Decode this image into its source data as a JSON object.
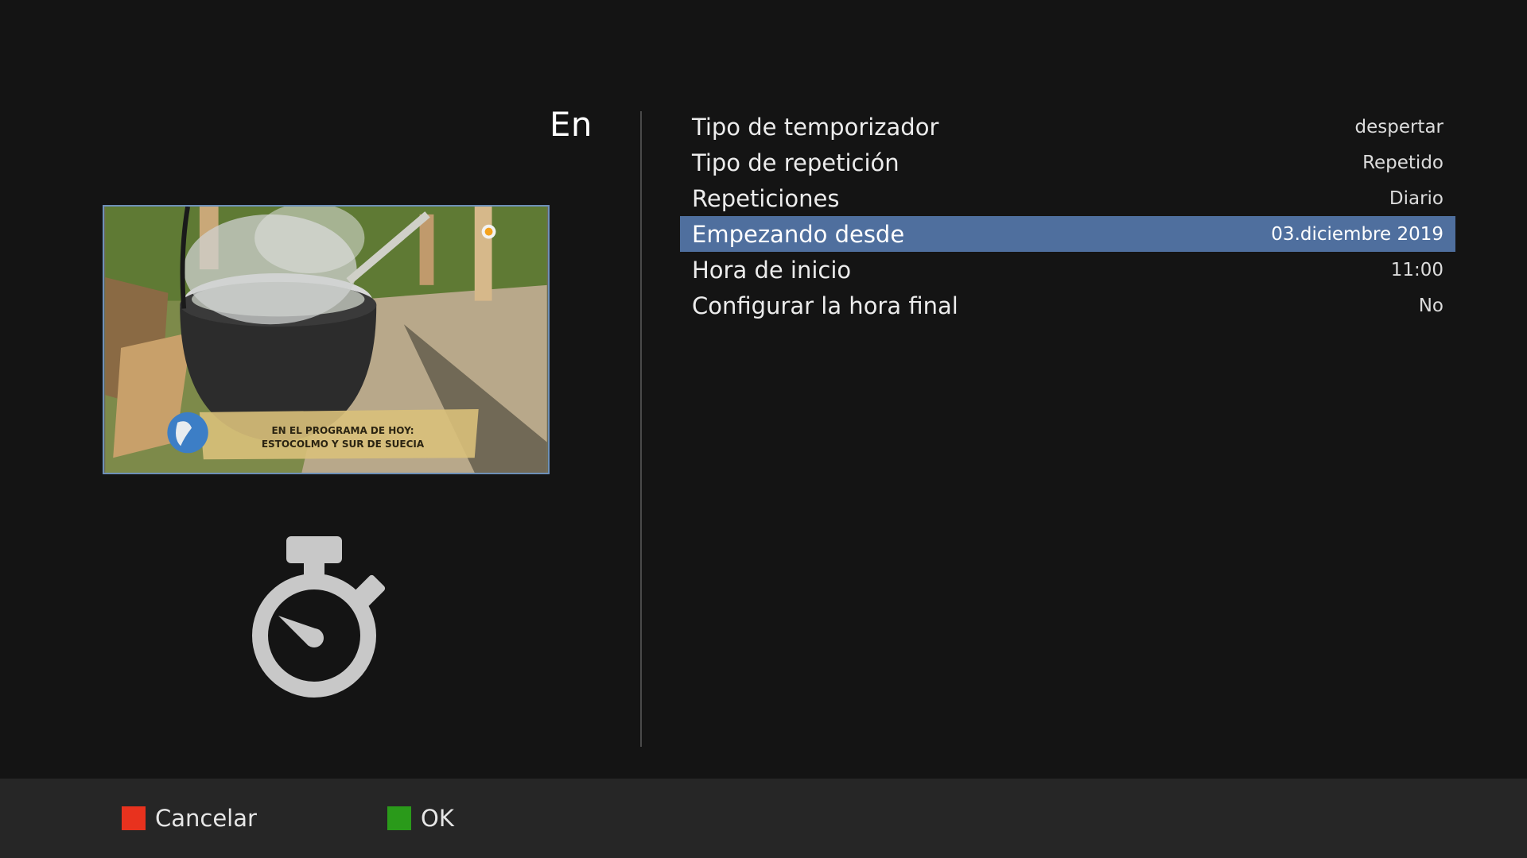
{
  "header": {
    "title": "En"
  },
  "preview": {
    "overlay_line1": "EN EL PROGRAMA DE HOY:",
    "overlay_line2": "ESTOCOLMO Y SUR DE SUECIA"
  },
  "icons": {
    "timer": "stopwatch-icon"
  },
  "settings": {
    "rows": [
      {
        "label": "Tipo de temporizador",
        "value": "despertar"
      },
      {
        "label": "Tipo de repetición",
        "value": "Repetido"
      },
      {
        "label": "Repeticiones",
        "value": "Diario"
      },
      {
        "label": "Empezando desde",
        "value": "03.diciembre 2019",
        "selected": true
      },
      {
        "label": "Hora de inicio",
        "value": "11:00"
      },
      {
        "label": "Configurar la hora final",
        "value": "No"
      }
    ]
  },
  "footer": {
    "cancel_label": "Cancelar",
    "ok_label": "OK"
  },
  "colors": {
    "background": "#141414",
    "selection": "#4f6f9e",
    "red_key": "#e8321e",
    "green_key": "#2a9a1a",
    "preview_border": "#6e90b8"
  }
}
